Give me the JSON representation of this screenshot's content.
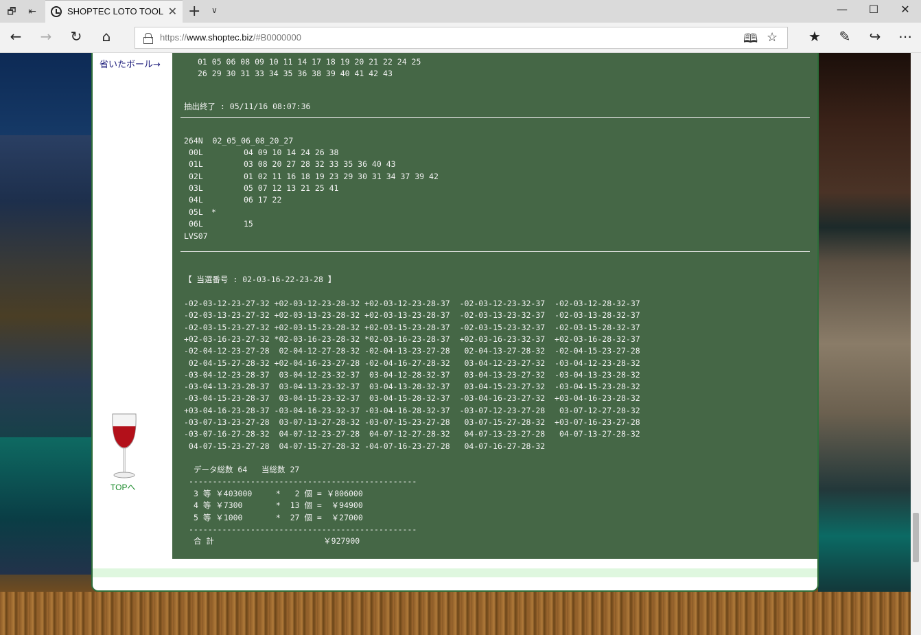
{
  "browser": {
    "tab_title": "SHOPTEC LOTO TOOL",
    "url_scheme": "https://",
    "url_host": "www.shoptec.biz",
    "url_path": "/#B0000000"
  },
  "sidebar": {
    "omitted_link": "省いたボール→",
    "top_link": "TOPへ"
  },
  "console": {
    "top_lines": [
      "01 05 06 08 09 10 11 14 17 18 19 20 21 22 24 25",
      "26 29 30 31 33 34 35 36 38 39 40 41 42 43"
    ],
    "extract_end": "抽出終了 : 05/11/16 08:07:36",
    "header_line": "264N  02_05_06_08_20_27",
    "levels": [
      {
        "label": "00L",
        "values": "04 09 10 14 24 26 38"
      },
      {
        "label": "01L",
        "values": "03 08 20 27 28 32 33 35 36 40 43"
      },
      {
        "label": "02L",
        "values": "01 02 11 16 18 19 23 29 30 31 34 37 39 42"
      },
      {
        "label": "03L",
        "values": "05 07 12 13 21 25 41"
      },
      {
        "label": "04L",
        "values": "06 17 22"
      },
      {
        "label": "05L",
        "values": "*"
      },
      {
        "label": "06L",
        "values": "15"
      }
    ],
    "lvs": "LVS07",
    "winning": "【 当選番号 : 02-03-16-22-23-28 】",
    "combos": [
      "-02-03-12-23-27-32 +02-03-12-23-28-32 +02-03-12-23-28-37  -02-03-12-23-32-37  -02-03-12-28-32-37",
      "-02-03-13-23-27-32 +02-03-13-23-28-32 +02-03-13-23-28-37  -02-03-13-23-32-37  -02-03-13-28-32-37",
      "-02-03-15-23-27-32 +02-03-15-23-28-32 +02-03-15-23-28-37  -02-03-15-23-32-37  -02-03-15-28-32-37",
      "+02-03-16-23-27-32 *02-03-16-23-28-32 *02-03-16-23-28-37  +02-03-16-23-32-37  +02-03-16-28-32-37",
      "-02-04-12-23-27-28  02-04-12-27-28-32 -02-04-13-23-27-28   02-04-13-27-28-32  -02-04-15-23-27-28",
      " 02-04-15-27-28-32 +02-04-16-23-27-28 -02-04-16-27-28-32   03-04-12-23-27-32  -03-04-12-23-28-32",
      "-03-04-12-23-28-37  03-04-12-23-32-37  03-04-12-28-32-37   03-04-13-23-27-32  -03-04-13-23-28-32",
      "-03-04-13-23-28-37  03-04-13-23-32-37  03-04-13-28-32-37   03-04-15-23-27-32  -03-04-15-23-28-32",
      "-03-04-15-23-28-37  03-04-15-23-32-37  03-04-15-28-32-37  -03-04-16-23-27-32  +03-04-16-23-28-32",
      "+03-04-16-23-28-37 -03-04-16-23-32-37 -03-04-16-28-32-37  -03-07-12-23-27-28   03-07-12-27-28-32",
      "-03-07-13-23-27-28  03-07-13-27-28-32 -03-07-15-23-27-28   03-07-15-27-28-32  +03-07-16-23-27-28",
      "-03-07-16-27-28-32  04-07-12-23-27-28  04-07-12-27-28-32   04-07-13-23-27-28   04-07-13-27-28-32",
      " 04-07-15-23-27-28  04-07-15-27-28-32 -04-07-16-23-27-28   04-07-16-27-28-32"
    ],
    "summary_title": "データ総数 64   当総数 27",
    "dash_line": "------------------------------------------------",
    "prizes": [
      "3 等 ￥403000     *   2 個 = ￥806000",
      "4 等 ￥7300       *  13 個 =  ￥94900",
      "5 等 ￥1000       *  27 個 =  ￥27000"
    ],
    "total": "合 計                       ￥927900"
  }
}
